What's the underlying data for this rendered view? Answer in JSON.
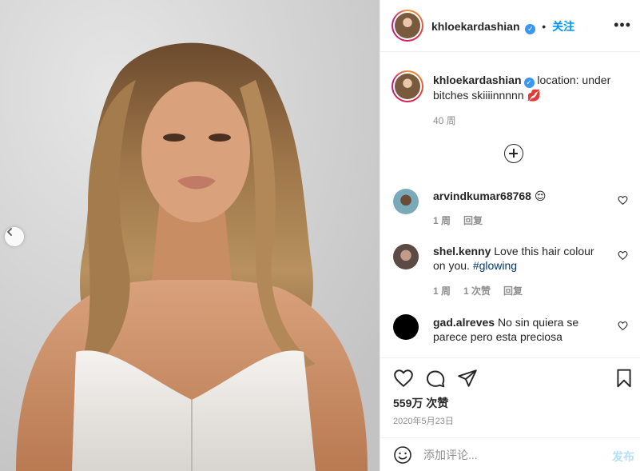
{
  "post": {
    "image_alt": "Woman with long wavy highlighted hair in a white corset top against a light grey background",
    "prev_icon": "chevron-left-icon"
  },
  "header": {
    "username": "khloekardashian",
    "verified_icon": "verified-badge-icon",
    "separator": "•",
    "follow_label": "关注",
    "more_icon": "more-horizontal-icon",
    "more_label": "•••"
  },
  "caption": {
    "username": "khloekardashian",
    "text": "location: under bitches skiiiinnnnn 💋",
    "time": "40 周"
  },
  "load_more_icon": "plus-circle-icon",
  "comments": [
    {
      "username": "arvindkumar68768",
      "text": "😌",
      "time": "1 周",
      "likes": "",
      "reply": "回复"
    },
    {
      "username": "shel.kenny",
      "text": "Love this hair colour on you.",
      "hashtag": "#glowing",
      "time": "1 周",
      "likes": "1 次赞",
      "reply": "回复"
    },
    {
      "username": "gad.alreves",
      "text": "No sin quiera se parece pero esta preciosa",
      "time": "",
      "likes": "",
      "reply": ""
    }
  ],
  "actions": {
    "like_icon": "heart-icon",
    "comment_icon": "comment-icon",
    "share_icon": "paper-plane-icon",
    "save_icon": "bookmark-icon"
  },
  "likes_text": "559万 次赞",
  "date_text": "2020年5月23日",
  "add_comment": {
    "emoji_icon": "smiley-icon",
    "placeholder": "添加评论...",
    "post_label": "发布"
  },
  "colors": {
    "link_blue": "#0095f6",
    "verified_blue": "#3897f0",
    "hashtag": "#00376b",
    "muted": "#8e8e8e",
    "post_disabled": "#b2dffc"
  }
}
